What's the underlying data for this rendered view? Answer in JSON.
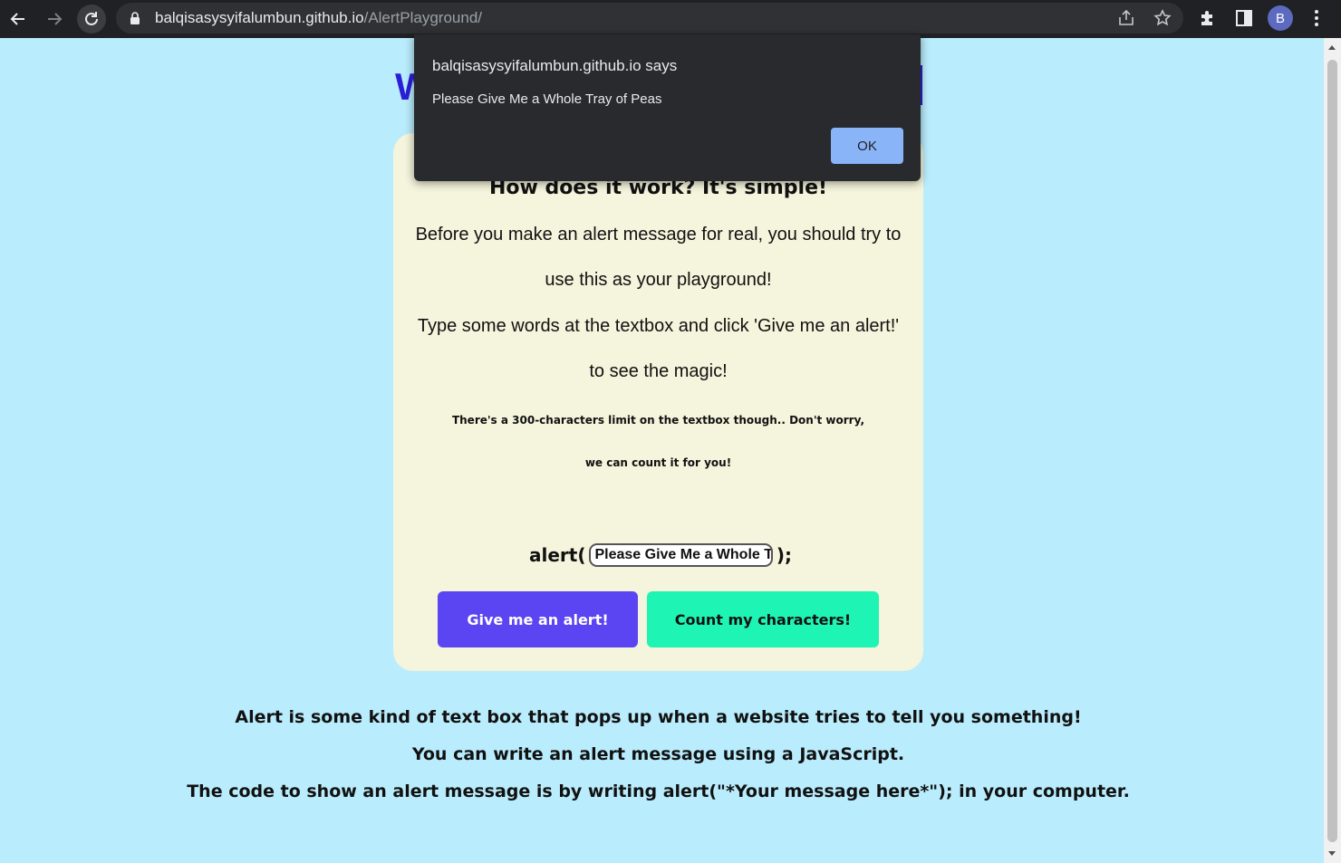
{
  "browser": {
    "url_host": "balqisasysyifalumbun.github.io",
    "url_path": "/AlertPlayground/",
    "profile_initial": "B",
    "colors": {
      "toolbar": "#202124",
      "omnibox": "#303134",
      "avatar": "#5c6bc0"
    }
  },
  "page": {
    "background": "#b9ecfc",
    "card": {
      "subtitle": "How does it work? It's simple!",
      "para1_line1": "Before you make an alert message for real, you should try to",
      "para1_line2": "use this as your playground!",
      "para2_line1": "Type some words at the textbox and click 'Give me an alert!'",
      "para2_line2": "to see the magic!",
      "note_line1": "There's a 300-characters limit on the textbox though.. Don't worry,",
      "note_line2": "we can count it for you!",
      "alert_prefix": "alert(",
      "alert_suffix": ");",
      "input_value": "Please Give Me a Whole Tr",
      "btn_alert": "Give me an alert!",
      "btn_count": "Count my characters!",
      "colors": {
        "card": "#f5f4dc",
        "btn_alert": "#5b44f2",
        "btn_count": "#1ef5b4"
      }
    },
    "info": {
      "line1": "Alert is some kind of text box that pops up when a website tries to tell you something!",
      "line2": "You can write an alert message using a JavaScript.",
      "line3": "The code to show an alert message is by writing alert(\"*Your message here*\"); in your computer."
    }
  },
  "dialog": {
    "title": "balqisasysyifalumbun.github.io says",
    "message": "Please Give Me a Whole Tray of Peas",
    "ok_label": "OK",
    "colors": {
      "background": "#292a2d",
      "ok": "#8ab4f8"
    }
  }
}
